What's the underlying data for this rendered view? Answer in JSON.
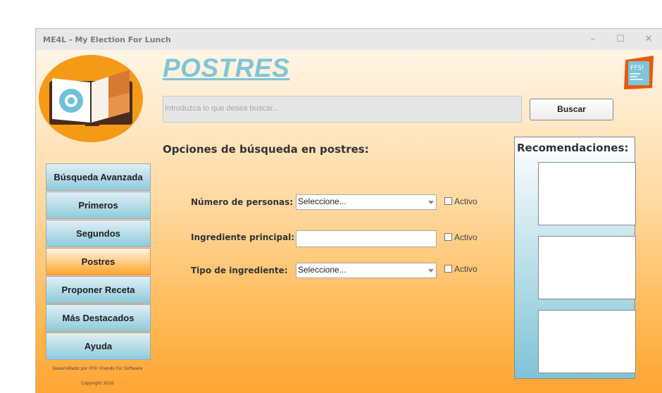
{
  "window": {
    "title": "ME4L - My Election For Lunch",
    "controls": {
      "minimize": "–",
      "maximize": "☐",
      "close": "✕"
    }
  },
  "branding": {
    "app_logo_icon": "open-book-logo-icon",
    "company_badge_text": "FFS!",
    "company_badge_icon": "ffs-logo-icon"
  },
  "header": {
    "page_title": "POSTRES",
    "search_placeholder": "Introduzca lo que desea buscar...",
    "search_button": "Buscar"
  },
  "options": {
    "heading": "Opciones de búsqueda en postres:",
    "fields": [
      {
        "label": "Número de personas:",
        "type": "select",
        "value": "Seleccione...",
        "checkbox_label": "Activo",
        "checked": false
      },
      {
        "label": "Ingrediente principal:",
        "type": "text",
        "value": "",
        "checkbox_label": "Activo",
        "checked": false
      },
      {
        "label": "Tipo de ingrediente:",
        "type": "select",
        "value": "Seleccione...",
        "checkbox_label": "Activo",
        "checked": false
      }
    ]
  },
  "sidebar": {
    "items": [
      {
        "label": "Búsqueda Avanzada",
        "active": false
      },
      {
        "label": "Primeros",
        "active": false
      },
      {
        "label": "Segundos",
        "active": false
      },
      {
        "label": "Postres",
        "active": true
      },
      {
        "label": "Proponer Receta",
        "active": false
      },
      {
        "label": "Más Destacados",
        "active": false
      },
      {
        "label": "Ayuda",
        "active": false
      }
    ],
    "footer_dev": "Desarrollado por FFS! Friends For Software",
    "footer_copy": "Copyright 2016"
  },
  "recommendations": {
    "title": "Recomendaciones:",
    "slots": 3
  },
  "colors": {
    "accent_blue": "#7fc4d9",
    "active_orange": "#ffa42a",
    "background_orange": "#ffb347"
  }
}
